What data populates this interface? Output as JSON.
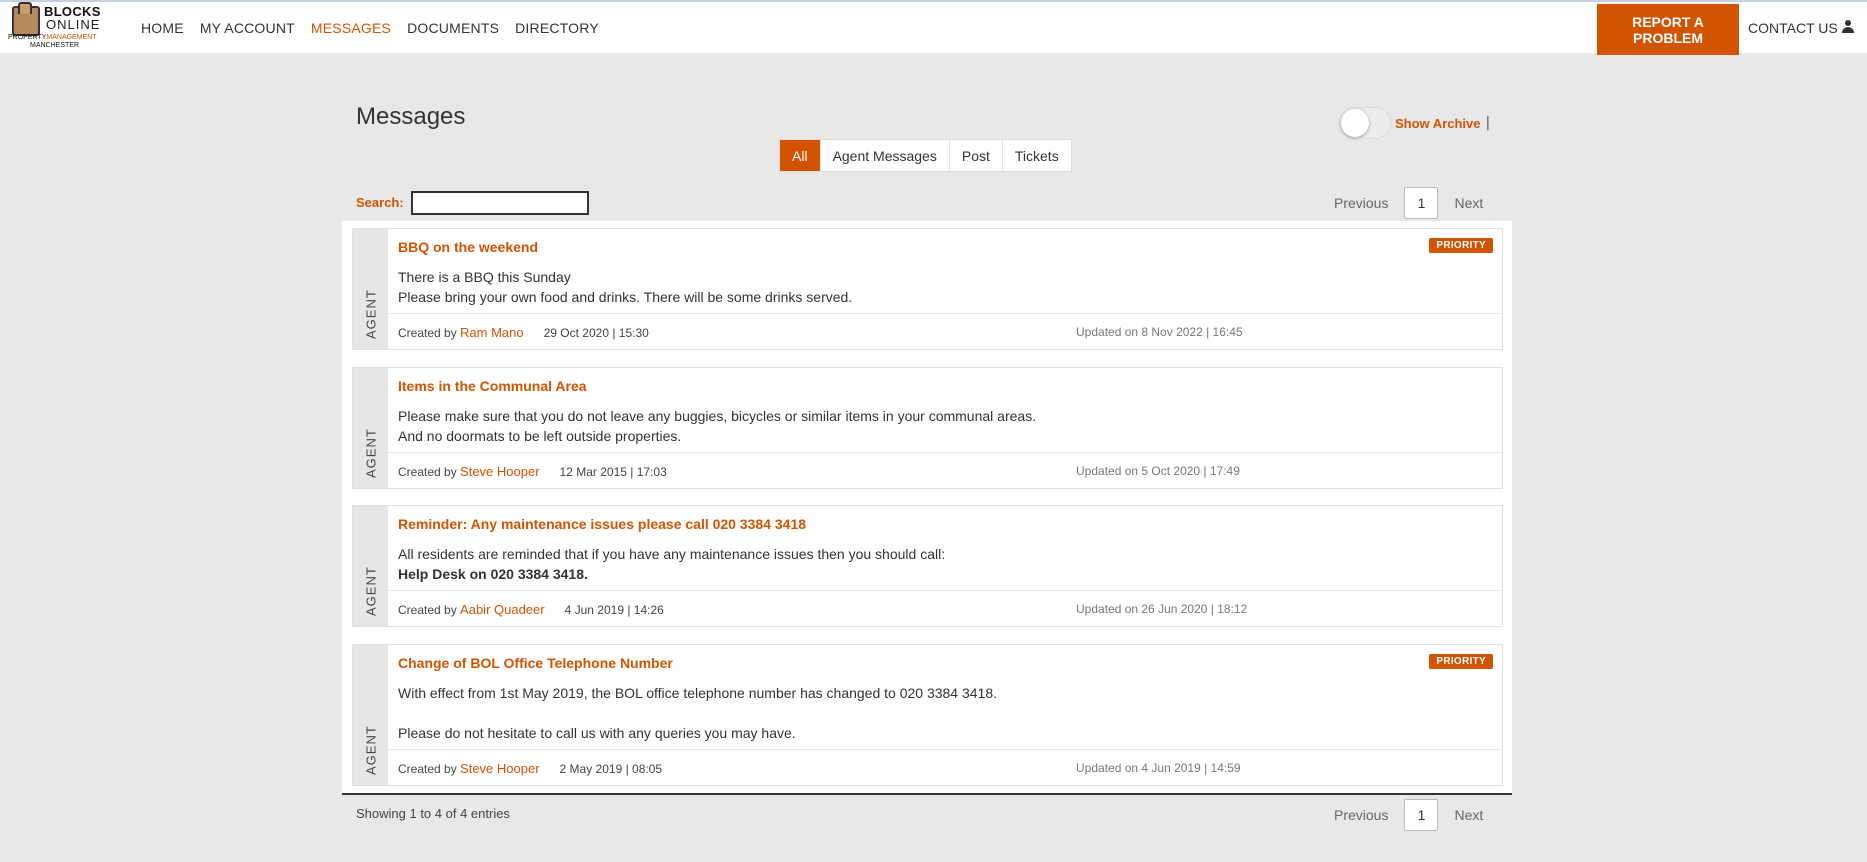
{
  "header": {
    "logo": {
      "line1": "BLOCKS",
      "line2": "ONLINE",
      "line3a": "PROPERTY",
      "line3b": "MANAGEMENT",
      "line4": "MANCHESTER"
    },
    "nav": [
      {
        "label": "HOME"
      },
      {
        "label": "MY ACCOUNT"
      },
      {
        "label": "MESSAGES"
      },
      {
        "label": "DOCUMENTS"
      },
      {
        "label": "DIRECTORY"
      }
    ],
    "report_button": "REPORT A PROBLEM",
    "contact": "CONTACT US"
  },
  "page": {
    "title": "Messages",
    "archive_label": "Show Archive",
    "archive_sep": "|",
    "tabs": [
      {
        "label": "All"
      },
      {
        "label": "Agent Messages"
      },
      {
        "label": "Post"
      },
      {
        "label": "Tickets"
      }
    ],
    "search_label": "Search:",
    "pager": {
      "prev": "Previous",
      "page": "1",
      "next": "Next"
    },
    "showing": "Showing 1 to 4 of 4 entries"
  },
  "messages": [
    {
      "side": "AGENT",
      "title": "BBQ on the weekend",
      "badge": "PRIORITY",
      "line1": "There is a BBQ this Sunday",
      "line2": "Please bring your own food and drinks. There will be some drinks served.",
      "created_prefix": "Created by",
      "author": "Ram Mano",
      "created_date": "29 Oct 2020 | 15:30",
      "updated": "Updated on 8 Nov 2022 | 16:45"
    },
    {
      "side": "AGENT",
      "title": "Items in the Communal Area",
      "badge": "",
      "line1": "Please make sure that you do not leave any buggies, bicycles or similar items in your communal areas.",
      "line2": "And no doormats to be left outside properties.",
      "created_prefix": "Created by",
      "author": "Steve Hooper",
      "created_date": "12 Mar 2015 | 17:03",
      "updated": "Updated on 5 Oct 2020 | 17:49"
    },
    {
      "side": "AGENT",
      "title": "Reminder: Any maintenance issues please call 020 3384 3418",
      "badge": "",
      "line1": "All residents are reminded that if you have any maintenance issues then you should call:",
      "line2": "Help Desk on 020 3384 3418.",
      "created_prefix": "Created by",
      "author": "Aabir Quadeer",
      "created_date": "4 Jun 2019 | 14:26",
      "updated": "Updated on 26 Jun 2020 | 18:12"
    },
    {
      "side": "AGENT",
      "title": "Change of BOL Office Telephone Number",
      "badge": "PRIORITY",
      "line1": "With effect from 1st May 2019, the BOL office telephone number has changed to 020 3384 3418.",
      "line2": "Please do not hesitate to call us with any queries you may have.",
      "created_prefix": "Created by",
      "author": "Steve Hooper",
      "created_date": "2 May 2019 | 08:05",
      "updated": "Updated on 4 Jun 2019 | 14:59"
    }
  ]
}
